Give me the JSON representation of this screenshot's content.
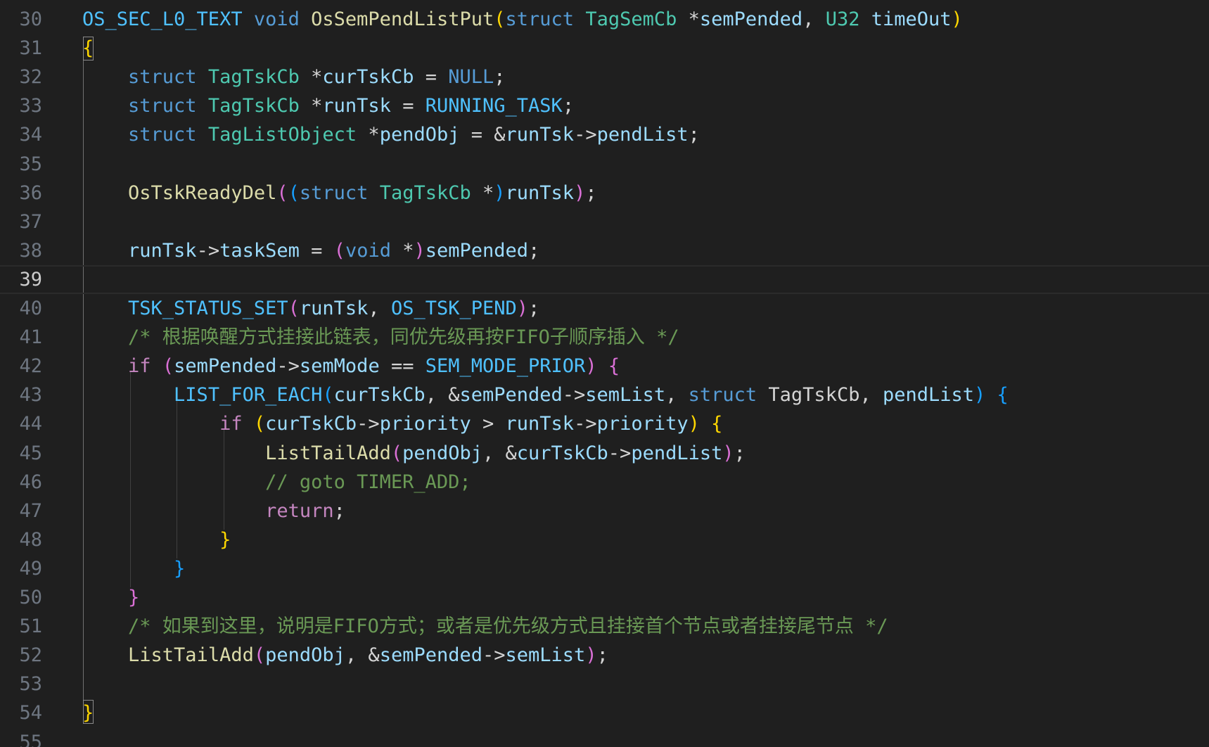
{
  "editor": {
    "lines": [
      {
        "n": "30",
        "tokens": [
          [
            "mc",
            "OS_SEC_L0_TEXT"
          ],
          [
            "pn",
            " "
          ],
          [
            "kw",
            "void"
          ],
          [
            "pn",
            " "
          ],
          [
            "fn",
            "OsSemPendListPut"
          ],
          [
            "b1",
            "("
          ],
          [
            "kw",
            "struct"
          ],
          [
            "pn",
            " "
          ],
          [
            "ty",
            "TagSemCb"
          ],
          [
            "pn",
            " *"
          ],
          [
            "vr",
            "semPended"
          ],
          [
            "pn",
            ", "
          ],
          [
            "ty",
            "U32"
          ],
          [
            "pn",
            " "
          ],
          [
            "vr",
            "timeOut"
          ],
          [
            "b1",
            ")"
          ]
        ]
      },
      {
        "n": "31",
        "tokens": [
          [
            "b1",
            "{"
          ]
        ]
      },
      {
        "n": "32",
        "tokens": [
          [
            "pn",
            "    "
          ],
          [
            "kw",
            "struct"
          ],
          [
            "pn",
            " "
          ],
          [
            "ty",
            "TagTskCb"
          ],
          [
            "pn",
            " *"
          ],
          [
            "vr",
            "curTskCb"
          ],
          [
            "pn",
            " = "
          ],
          [
            "kw",
            "NULL"
          ],
          [
            "pn",
            ";"
          ]
        ]
      },
      {
        "n": "33",
        "tokens": [
          [
            "pn",
            "    "
          ],
          [
            "kw",
            "struct"
          ],
          [
            "pn",
            " "
          ],
          [
            "ty",
            "TagTskCb"
          ],
          [
            "pn",
            " *"
          ],
          [
            "vr",
            "runTsk"
          ],
          [
            "pn",
            " = "
          ],
          [
            "mc",
            "RUNNING_TASK"
          ],
          [
            "pn",
            ";"
          ]
        ]
      },
      {
        "n": "34",
        "tokens": [
          [
            "pn",
            "    "
          ],
          [
            "kw",
            "struct"
          ],
          [
            "pn",
            " "
          ],
          [
            "ty",
            "TagListObject"
          ],
          [
            "pn",
            " *"
          ],
          [
            "vr",
            "pendObj"
          ],
          [
            "pn",
            " = &"
          ],
          [
            "vr",
            "runTsk"
          ],
          [
            "pn",
            "->"
          ],
          [
            "vr",
            "pendList"
          ],
          [
            "pn",
            ";"
          ]
        ]
      },
      {
        "n": "35",
        "tokens": []
      },
      {
        "n": "36",
        "tokens": [
          [
            "pn",
            "    "
          ],
          [
            "fn",
            "OsTskReadyDel"
          ],
          [
            "b2",
            "("
          ],
          [
            "b3",
            "("
          ],
          [
            "kw",
            "struct"
          ],
          [
            "pn",
            " "
          ],
          [
            "ty",
            "TagTskCb"
          ],
          [
            "pn",
            " *"
          ],
          [
            "b3",
            ")"
          ],
          [
            "vr",
            "runTsk"
          ],
          [
            "b2",
            ")"
          ],
          [
            "pn",
            ";"
          ]
        ]
      },
      {
        "n": "37",
        "tokens": []
      },
      {
        "n": "38",
        "tokens": [
          [
            "pn",
            "    "
          ],
          [
            "vr",
            "runTsk"
          ],
          [
            "pn",
            "->"
          ],
          [
            "vr",
            "taskSem"
          ],
          [
            "pn",
            " = "
          ],
          [
            "b2",
            "("
          ],
          [
            "kw",
            "void"
          ],
          [
            "pn",
            " *"
          ],
          [
            "b2",
            ")"
          ],
          [
            "vr",
            "semPended"
          ],
          [
            "pn",
            ";"
          ]
        ]
      },
      {
        "n": "39",
        "current": true,
        "tokens": []
      },
      {
        "n": "40",
        "tokens": [
          [
            "pn",
            "    "
          ],
          [
            "mc",
            "TSK_STATUS_SET"
          ],
          [
            "b2",
            "("
          ],
          [
            "vr",
            "runTsk"
          ],
          [
            "pn",
            ", "
          ],
          [
            "mc",
            "OS_TSK_PEND"
          ],
          [
            "b2",
            ")"
          ],
          [
            "pn",
            ";"
          ]
        ]
      },
      {
        "n": "41",
        "tokens": [
          [
            "pn",
            "    "
          ],
          [
            "cm",
            "/* 根据唤醒方式挂接此链表，同优先级再按FIFO子顺序插入 */"
          ]
        ]
      },
      {
        "n": "42",
        "tokens": [
          [
            "pn",
            "    "
          ],
          [
            "ctl",
            "if"
          ],
          [
            "pn",
            " "
          ],
          [
            "b2",
            "("
          ],
          [
            "vr",
            "semPended"
          ],
          [
            "pn",
            "->"
          ],
          [
            "vr",
            "semMode"
          ],
          [
            "pn",
            " == "
          ],
          [
            "mc",
            "SEM_MODE_PRIOR"
          ],
          [
            "b2",
            ")"
          ],
          [
            "pn",
            " "
          ],
          [
            "b2",
            "{"
          ]
        ]
      },
      {
        "n": "43",
        "tokens": [
          [
            "pn",
            "        "
          ],
          [
            "mc",
            "LIST_FOR_EACH"
          ],
          [
            "b3",
            "("
          ],
          [
            "vr",
            "curTskCb"
          ],
          [
            "pn",
            ", &"
          ],
          [
            "vr",
            "semPended"
          ],
          [
            "pn",
            "->"
          ],
          [
            "vr",
            "semList"
          ],
          [
            "pn",
            ", "
          ],
          [
            "kw",
            "struct"
          ],
          [
            "pn",
            " TagTskCb, "
          ],
          [
            "vr",
            "pendList"
          ],
          [
            "b3",
            ")"
          ],
          [
            "pn",
            " "
          ],
          [
            "b3",
            "{"
          ]
        ]
      },
      {
        "n": "44",
        "tokens": [
          [
            "pn",
            "            "
          ],
          [
            "ctl",
            "if"
          ],
          [
            "pn",
            " "
          ],
          [
            "b1",
            "("
          ],
          [
            "vr",
            "curTskCb"
          ],
          [
            "pn",
            "->"
          ],
          [
            "vr",
            "priority"
          ],
          [
            "pn",
            " > "
          ],
          [
            "vr",
            "runTsk"
          ],
          [
            "pn",
            "->"
          ],
          [
            "vr",
            "priority"
          ],
          [
            "b1",
            ")"
          ],
          [
            "pn",
            " "
          ],
          [
            "b1",
            "{"
          ]
        ]
      },
      {
        "n": "45",
        "tokens": [
          [
            "pn",
            "                "
          ],
          [
            "fn",
            "ListTailAdd"
          ],
          [
            "b2",
            "("
          ],
          [
            "vr",
            "pendObj"
          ],
          [
            "pn",
            ", &"
          ],
          [
            "vr",
            "curTskCb"
          ],
          [
            "pn",
            "->"
          ],
          [
            "vr",
            "pendList"
          ],
          [
            "b2",
            ")"
          ],
          [
            "pn",
            ";"
          ]
        ]
      },
      {
        "n": "46",
        "tokens": [
          [
            "pn",
            "                "
          ],
          [
            "cm",
            "// goto TIMER_ADD;"
          ]
        ]
      },
      {
        "n": "47",
        "tokens": [
          [
            "pn",
            "                "
          ],
          [
            "ctl",
            "return"
          ],
          [
            "pn",
            ";"
          ]
        ]
      },
      {
        "n": "48",
        "tokens": [
          [
            "pn",
            "            "
          ],
          [
            "b1",
            "}"
          ]
        ]
      },
      {
        "n": "49",
        "tokens": [
          [
            "pn",
            "        "
          ],
          [
            "b3",
            "}"
          ]
        ]
      },
      {
        "n": "50",
        "tokens": [
          [
            "pn",
            "    "
          ],
          [
            "b2",
            "}"
          ]
        ]
      },
      {
        "n": "51",
        "tokens": [
          [
            "pn",
            "    "
          ],
          [
            "cm",
            "/* 如果到这里，说明是FIFO方式；或者是优先级方式且挂接首个节点或者挂接尾节点 */"
          ]
        ]
      },
      {
        "n": "52",
        "tokens": [
          [
            "pn",
            "    "
          ],
          [
            "fn",
            "ListTailAdd"
          ],
          [
            "b2",
            "("
          ],
          [
            "vr",
            "pendObj"
          ],
          [
            "pn",
            ", &"
          ],
          [
            "vr",
            "semPended"
          ],
          [
            "pn",
            "->"
          ],
          [
            "vr",
            "semList"
          ],
          [
            "b2",
            ")"
          ],
          [
            "pn",
            ";"
          ]
        ]
      },
      {
        "n": "53",
        "tokens": []
      },
      {
        "n": "54",
        "tokens": [
          [
            "b1",
            "}"
          ]
        ]
      },
      {
        "n": "55",
        "tokens": []
      }
    ]
  }
}
